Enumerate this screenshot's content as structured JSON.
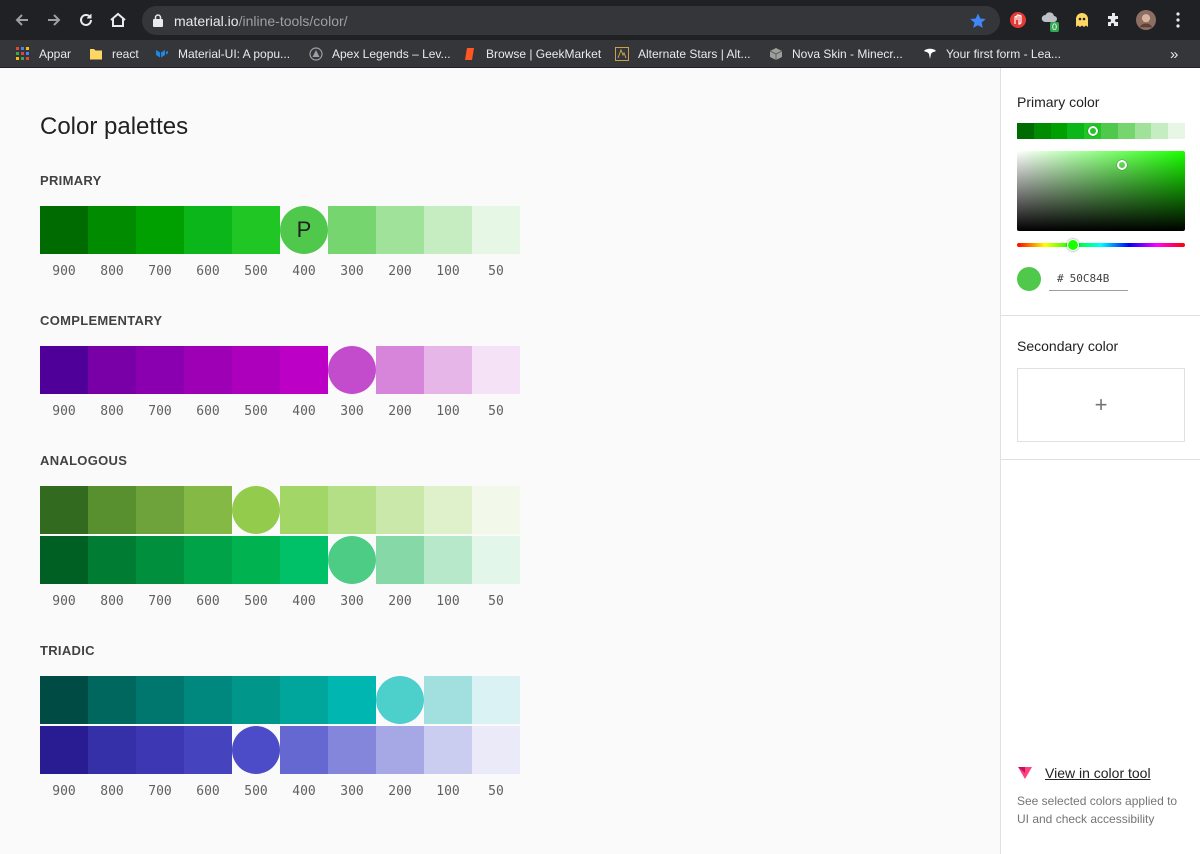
{
  "browser": {
    "url_host": "material.io",
    "url_path": "/inline-tools/color/",
    "icons": [
      "back-icon",
      "forward-icon",
      "reload-icon",
      "home-icon",
      "lock-icon",
      "star-icon",
      "extensions-icon",
      "menu-icon"
    ],
    "bookmarks": [
      {
        "label": "Appar",
        "icon": "apps-grid-icon",
        "color": "#ea4335"
      },
      {
        "label": "react",
        "icon": "folder-icon",
        "color": "#fdd663"
      },
      {
        "label": "Material-UI: A popu...",
        "icon": "mui-logo-icon",
        "color": "#1e88e5"
      },
      {
        "label": "Apex Legends – Lev...",
        "icon": "apex-logo-icon",
        "color": "#9aa0a6"
      },
      {
        "label": "Browse | GeekMarket",
        "icon": "geekmarket-logo-icon",
        "color": "#ff5722"
      },
      {
        "label": "Alternate Stars | Alt...",
        "icon": "alternate-stars-icon",
        "color": "#c8a24a"
      },
      {
        "label": "Nova Skin - Minecr...",
        "icon": "nova-skin-icon",
        "color": "#9e9e9e"
      },
      {
        "label": "Your first form - Lea...",
        "icon": "formspree-logo-icon",
        "color": "#ffffff"
      }
    ],
    "more_label": "»",
    "badge_count": "0"
  },
  "page": {
    "title": "Color palettes",
    "shade_labels": [
      "900",
      "800",
      "700",
      "600",
      "500",
      "400",
      "300",
      "200",
      "100",
      "50"
    ],
    "primary": {
      "title": "PRIMARY",
      "marker_letter": "P",
      "selected_index": 5,
      "colors": [
        "#006b00",
        "#008b00",
        "#00a000",
        "#0ab61a",
        "#1fc624",
        "#50c84b",
        "#76d56f",
        "#a0e299",
        "#c6edc2",
        "#e7f7e6"
      ]
    },
    "complementary": {
      "title": "COMPLEMENTARY",
      "selected_index": 6,
      "colors": [
        "#4f0099",
        "#7800a6",
        "#8a00b0",
        "#9e00b6",
        "#ac00bc",
        "#bc00c5",
        "#c34ccd",
        "#d785da",
        "#e7b6e8",
        "#f5e2f6"
      ]
    },
    "analogous": {
      "title": "ANALOGOUS",
      "rows": [
        {
          "selected_index": 4,
          "colors": [
            "#326b1f",
            "#588f2f",
            "#6ea23a",
            "#84b945",
            "#93cc4c",
            "#a2d767",
            "#b4df86",
            "#c9e8a9",
            "#def1cb",
            "#f2f9ea"
          ]
        },
        {
          "selected_index": 6,
          "colors": [
            "#005f22",
            "#007c33",
            "#008f3c",
            "#00a347",
            "#00b250",
            "#00c168",
            "#4ccc85",
            "#86d9a7",
            "#b7e8c9",
            "#e2f6e9"
          ]
        }
      ]
    },
    "triadic": {
      "title": "TRIADIC",
      "rows": [
        {
          "selected_index": 7,
          "colors": [
            "#004b43",
            "#00675e",
            "#00776e",
            "#00887e",
            "#00968a",
            "#00a69b",
            "#00b6b0",
            "#4dcfcb",
            "#a2e0df",
            "#daf2f3"
          ]
        },
        {
          "selected_index": 4,
          "colors": [
            "#291c93",
            "#3530a8",
            "#3d37b4",
            "#4643be",
            "#4c4bc8",
            "#6668d2",
            "#8386da",
            "#a6a8e5",
            "#caccf0",
            "#eaeaf9"
          ]
        }
      ]
    }
  },
  "sidebar": {
    "primary_label": "Primary color",
    "strip_colors": [
      "#006b00",
      "#008b00",
      "#00a000",
      "#0ab61a",
      "#1fc624",
      "#50c84b",
      "#76d56f",
      "#a0e299",
      "#c6edc2",
      "#e7f7e6"
    ],
    "selected_color": "#50c84b",
    "hex_prefix": "#",
    "hex_value": "50C84B",
    "secondary_label": "Secondary color",
    "add_symbol": "+",
    "view_link": "View in color tool",
    "note": "See selected colors applied to UI and check accessibility"
  }
}
